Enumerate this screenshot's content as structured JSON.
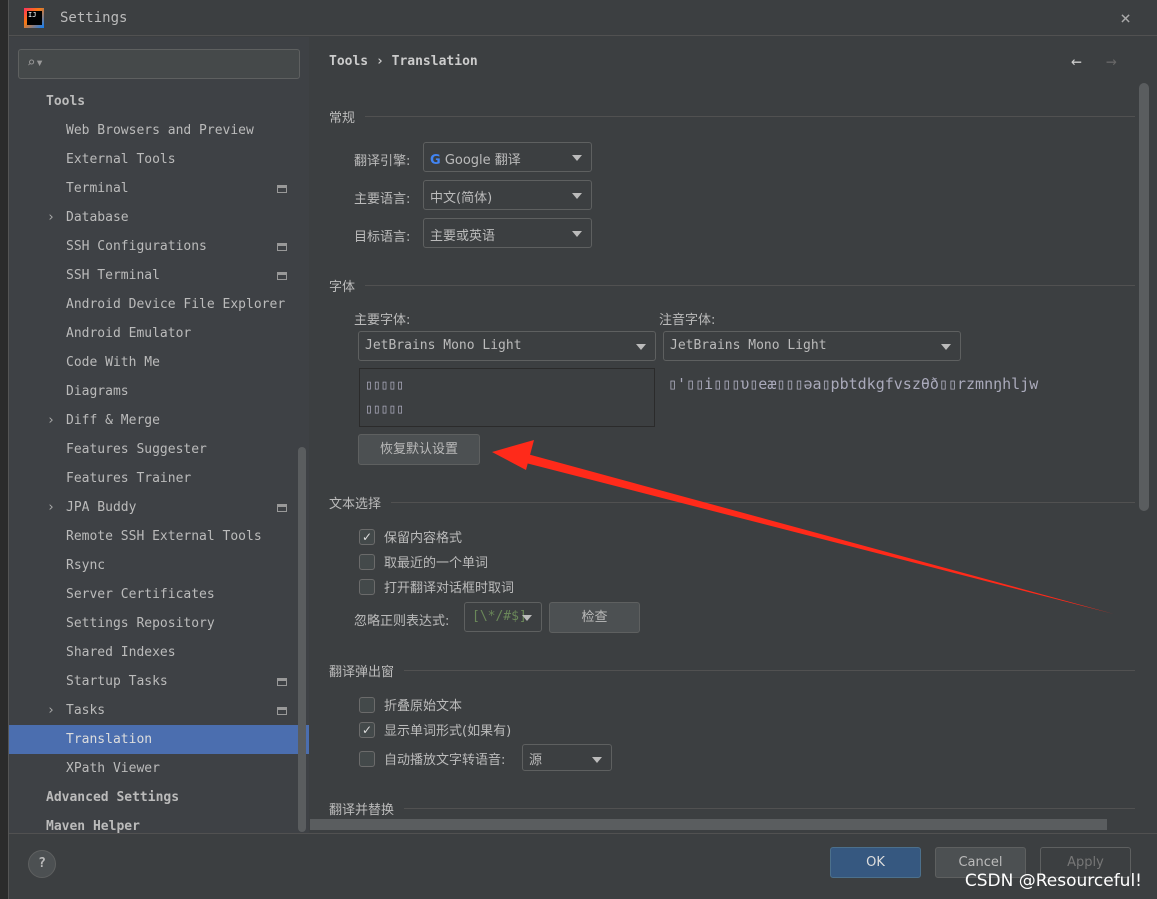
{
  "window": {
    "title": "Settings",
    "close": "×"
  },
  "sidebar": {
    "search_icon": "⌕▾",
    "items": [
      {
        "label": "Tools",
        "type": "top"
      },
      {
        "label": "Web Browsers and Preview"
      },
      {
        "label": "External Tools"
      },
      {
        "label": "Terminal",
        "mark": true
      },
      {
        "label": "Database",
        "chev": true
      },
      {
        "label": "SSH Configurations",
        "mark": true
      },
      {
        "label": "SSH Terminal",
        "mark": true
      },
      {
        "label": "Android Device File Explorer"
      },
      {
        "label": "Android Emulator"
      },
      {
        "label": "Code With Me"
      },
      {
        "label": "Diagrams"
      },
      {
        "label": "Diff & Merge",
        "chev": true
      },
      {
        "label": "Features Suggester"
      },
      {
        "label": "Features Trainer"
      },
      {
        "label": "JPA Buddy",
        "chev": true,
        "mark": true
      },
      {
        "label": "Remote SSH External Tools"
      },
      {
        "label": "Rsync"
      },
      {
        "label": "Server Certificates"
      },
      {
        "label": "Settings Repository"
      },
      {
        "label": "Shared Indexes"
      },
      {
        "label": "Startup Tasks",
        "mark": true
      },
      {
        "label": "Tasks",
        "chev": true,
        "mark": true
      },
      {
        "label": "Translation",
        "selected": true
      },
      {
        "label": "XPath Viewer"
      },
      {
        "label": "Advanced Settings",
        "type": "top"
      },
      {
        "label": "Maven Helper",
        "type": "top"
      }
    ]
  },
  "breadcrumb": {
    "parent": "Tools",
    "sep": "›",
    "current": "Translation",
    "back": "←",
    "forward": "→"
  },
  "general": {
    "title": "常规",
    "engine_label": "翻译引擎:",
    "engine": "Google 翻译",
    "primary_label": "主要语言:",
    "primary": "中文(简体)",
    "target_label": "目标语言:",
    "target": "主要或英语"
  },
  "font": {
    "title": "字体",
    "primary_label": "主要字体:",
    "primary": "JetBrains Mono Light",
    "phonetic_label": "注音字体:",
    "phonetic": "JetBrains Mono Light",
    "preview_line1": "▯▯▯▯▯",
    "preview_line2": "▯▯▯▯▯",
    "phonetic_preview": "▯'▯▯i▯▯▯υ▯eæ▯▯▯əa▯pbtdkgfvszθð▯▯rzmnŋhljw",
    "reset": "恢复默认设置"
  },
  "selection": {
    "title": "文本选择",
    "keep_format": "保留内容格式",
    "keep_format_checked": true,
    "nearest_word": "取最近的一个单词",
    "nearest_word_checked": false,
    "on_open": "打开翻译对话框时取词",
    "on_open_checked": false,
    "ignore_label": "忽略正则表达式:",
    "ignore_value": "[\\*/#$]",
    "check": "检查"
  },
  "popup": {
    "title": "翻译弹出窗",
    "fold": "折叠原始文本",
    "fold_checked": false,
    "word_forms": "显示单词形式(如果有)",
    "word_forms_checked": true,
    "autoplay": "自动播放文字转语音:",
    "autoplay_checked": false,
    "autoplay_source": "源"
  },
  "replace": {
    "title": "翻译并替换"
  },
  "footer": {
    "help": "?",
    "ok": "OK",
    "cancel": "Cancel",
    "apply": "Apply"
  },
  "watermark": "CSDN @Resourceful!",
  "colors": {
    "selection": "#4b6eaf",
    "ok": "#365880",
    "arrow": "#ff2a1a"
  }
}
